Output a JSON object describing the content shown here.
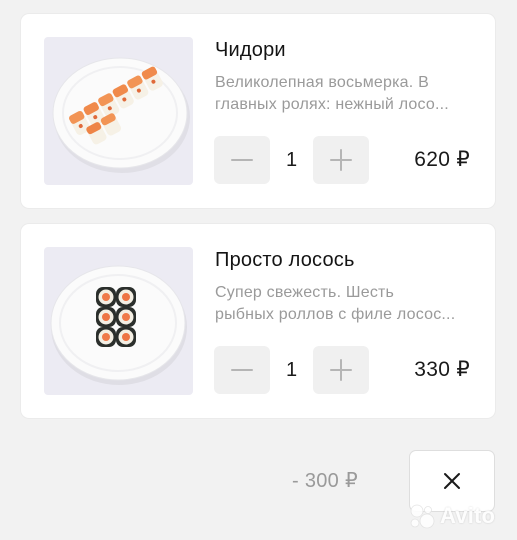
{
  "cart": {
    "items": [
      {
        "title": "Чидори",
        "description_lines": [
          "Великолепная восьмерка. В",
          "главных ролях: нежный лосо..."
        ],
        "quantity": "1",
        "price": "620 ₽",
        "image_icon": "sushi-rolls-salmon-icon"
      },
      {
        "title": "Просто лосось",
        "description_lines": [
          "Супер свежесть. Шесть",
          "рыбных роллов с филе лосос..."
        ],
        "quantity": "1",
        "price": "330 ₽",
        "image_icon": "sushi-maki-salmon-icon"
      }
    ],
    "discount": "- 300 ₽"
  },
  "watermark": {
    "text": "Avito"
  },
  "colors": {
    "card_bg": "#ffffff",
    "page_bg": "#f2f2f2",
    "thumb_bg": "#ecebf3",
    "stepper_bg": "#f0f0f0",
    "muted_text": "#9a9a9a",
    "icon_gray": "#b5b5b5",
    "salmon": "#f08a4b"
  }
}
